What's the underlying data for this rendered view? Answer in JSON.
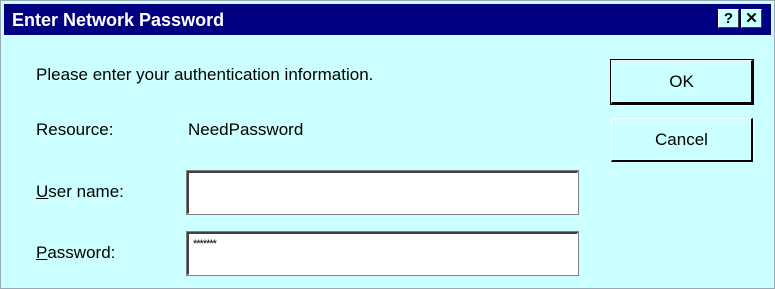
{
  "window": {
    "title": "Enter Network Password",
    "help_label": "?",
    "close_label": "✕"
  },
  "dialog": {
    "prompt": "Please enter your authentication information.",
    "resource_label": "Resource:",
    "resource_value": "NeedPassword",
    "username_label_mnemonic": "U",
    "username_label_rest": "ser name:",
    "username_value": "",
    "password_label_mnemonic": "P",
    "password_label_rest": "assword:",
    "password_value": "*******"
  },
  "buttons": {
    "ok_label": "OK",
    "cancel_label": "Cancel"
  },
  "colors": {
    "titlebar": "#000080",
    "dialog_background": "#ccffff"
  },
  "icons": {
    "help": "question-mark-icon",
    "close": "close-icon"
  }
}
